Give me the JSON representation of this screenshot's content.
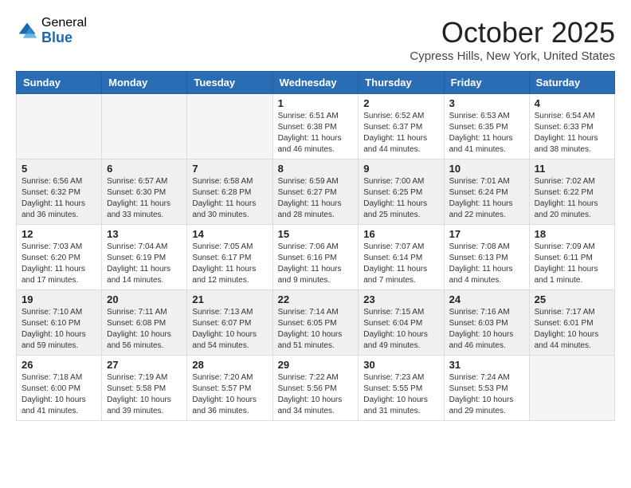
{
  "header": {
    "logo_general": "General",
    "logo_blue": "Blue",
    "month_title": "October 2025",
    "location": "Cypress Hills, New York, United States"
  },
  "days_of_week": [
    "Sunday",
    "Monday",
    "Tuesday",
    "Wednesday",
    "Thursday",
    "Friday",
    "Saturday"
  ],
  "weeks": [
    [
      {
        "day": "",
        "info": ""
      },
      {
        "day": "",
        "info": ""
      },
      {
        "day": "",
        "info": ""
      },
      {
        "day": "1",
        "info": "Sunrise: 6:51 AM\nSunset: 6:38 PM\nDaylight: 11 hours and 46 minutes."
      },
      {
        "day": "2",
        "info": "Sunrise: 6:52 AM\nSunset: 6:37 PM\nDaylight: 11 hours and 44 minutes."
      },
      {
        "day": "3",
        "info": "Sunrise: 6:53 AM\nSunset: 6:35 PM\nDaylight: 11 hours and 41 minutes."
      },
      {
        "day": "4",
        "info": "Sunrise: 6:54 AM\nSunset: 6:33 PM\nDaylight: 11 hours and 38 minutes."
      }
    ],
    [
      {
        "day": "5",
        "info": "Sunrise: 6:56 AM\nSunset: 6:32 PM\nDaylight: 11 hours and 36 minutes."
      },
      {
        "day": "6",
        "info": "Sunrise: 6:57 AM\nSunset: 6:30 PM\nDaylight: 11 hours and 33 minutes."
      },
      {
        "day": "7",
        "info": "Sunrise: 6:58 AM\nSunset: 6:28 PM\nDaylight: 11 hours and 30 minutes."
      },
      {
        "day": "8",
        "info": "Sunrise: 6:59 AM\nSunset: 6:27 PM\nDaylight: 11 hours and 28 minutes."
      },
      {
        "day": "9",
        "info": "Sunrise: 7:00 AM\nSunset: 6:25 PM\nDaylight: 11 hours and 25 minutes."
      },
      {
        "day": "10",
        "info": "Sunrise: 7:01 AM\nSunset: 6:24 PM\nDaylight: 11 hours and 22 minutes."
      },
      {
        "day": "11",
        "info": "Sunrise: 7:02 AM\nSunset: 6:22 PM\nDaylight: 11 hours and 20 minutes."
      }
    ],
    [
      {
        "day": "12",
        "info": "Sunrise: 7:03 AM\nSunset: 6:20 PM\nDaylight: 11 hours and 17 minutes."
      },
      {
        "day": "13",
        "info": "Sunrise: 7:04 AM\nSunset: 6:19 PM\nDaylight: 11 hours and 14 minutes."
      },
      {
        "day": "14",
        "info": "Sunrise: 7:05 AM\nSunset: 6:17 PM\nDaylight: 11 hours and 12 minutes."
      },
      {
        "day": "15",
        "info": "Sunrise: 7:06 AM\nSunset: 6:16 PM\nDaylight: 11 hours and 9 minutes."
      },
      {
        "day": "16",
        "info": "Sunrise: 7:07 AM\nSunset: 6:14 PM\nDaylight: 11 hours and 7 minutes."
      },
      {
        "day": "17",
        "info": "Sunrise: 7:08 AM\nSunset: 6:13 PM\nDaylight: 11 hours and 4 minutes."
      },
      {
        "day": "18",
        "info": "Sunrise: 7:09 AM\nSunset: 6:11 PM\nDaylight: 11 hours and 1 minute."
      }
    ],
    [
      {
        "day": "19",
        "info": "Sunrise: 7:10 AM\nSunset: 6:10 PM\nDaylight: 10 hours and 59 minutes."
      },
      {
        "day": "20",
        "info": "Sunrise: 7:11 AM\nSunset: 6:08 PM\nDaylight: 10 hours and 56 minutes."
      },
      {
        "day": "21",
        "info": "Sunrise: 7:13 AM\nSunset: 6:07 PM\nDaylight: 10 hours and 54 minutes."
      },
      {
        "day": "22",
        "info": "Sunrise: 7:14 AM\nSunset: 6:05 PM\nDaylight: 10 hours and 51 minutes."
      },
      {
        "day": "23",
        "info": "Sunrise: 7:15 AM\nSunset: 6:04 PM\nDaylight: 10 hours and 49 minutes."
      },
      {
        "day": "24",
        "info": "Sunrise: 7:16 AM\nSunset: 6:03 PM\nDaylight: 10 hours and 46 minutes."
      },
      {
        "day": "25",
        "info": "Sunrise: 7:17 AM\nSunset: 6:01 PM\nDaylight: 10 hours and 44 minutes."
      }
    ],
    [
      {
        "day": "26",
        "info": "Sunrise: 7:18 AM\nSunset: 6:00 PM\nDaylight: 10 hours and 41 minutes."
      },
      {
        "day": "27",
        "info": "Sunrise: 7:19 AM\nSunset: 5:58 PM\nDaylight: 10 hours and 39 minutes."
      },
      {
        "day": "28",
        "info": "Sunrise: 7:20 AM\nSunset: 5:57 PM\nDaylight: 10 hours and 36 minutes."
      },
      {
        "day": "29",
        "info": "Sunrise: 7:22 AM\nSunset: 5:56 PM\nDaylight: 10 hours and 34 minutes."
      },
      {
        "day": "30",
        "info": "Sunrise: 7:23 AM\nSunset: 5:55 PM\nDaylight: 10 hours and 31 minutes."
      },
      {
        "day": "31",
        "info": "Sunrise: 7:24 AM\nSunset: 5:53 PM\nDaylight: 10 hours and 29 minutes."
      },
      {
        "day": "",
        "info": ""
      }
    ]
  ]
}
